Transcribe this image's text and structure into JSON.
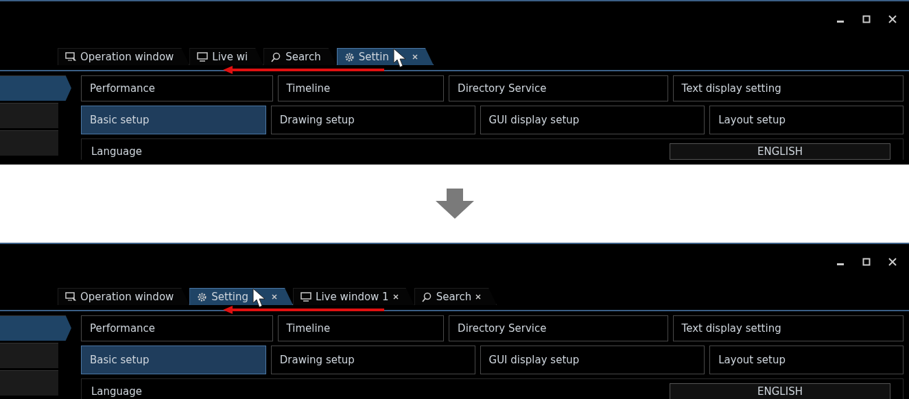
{
  "screens": [
    {
      "tabs": [
        {
          "kind": "operation",
          "label": "Operation window",
          "selected": false,
          "closable": false,
          "cursor": false
        },
        {
          "kind": "live",
          "label": "Live wi",
          "selected": false,
          "closable": false,
          "cursor": false
        },
        {
          "kind": "search",
          "label": "Search",
          "selected": false,
          "closable": false,
          "cursor": false
        },
        {
          "kind": "setting",
          "label": "Settin",
          "selected": true,
          "closable": true,
          "cursor": true
        }
      ],
      "drag_arrow": true,
      "sidebar": [
        {
          "selected": true
        },
        {
          "selected": false
        },
        {
          "selected": false
        }
      ],
      "menu_row_1": [
        {
          "label": "Performance",
          "selected": false
        },
        {
          "label": "Timeline",
          "selected": false
        },
        {
          "label": "Directory Service",
          "selected": false
        },
        {
          "label": "Text display setting",
          "selected": false
        }
      ],
      "menu_row_2": [
        {
          "label": "Basic setup",
          "selected": true
        },
        {
          "label": "Drawing setup",
          "selected": false
        },
        {
          "label": "GUI display setup",
          "selected": false
        },
        {
          "label": "Layout setup",
          "selected": false
        }
      ],
      "language": {
        "label": "Language",
        "value": "ENGLISH"
      }
    },
    {
      "tabs": [
        {
          "kind": "operation",
          "label": "Operation window",
          "selected": false,
          "closable": false,
          "cursor": false
        },
        {
          "kind": "setting",
          "label": "Setting",
          "selected": true,
          "closable": true,
          "cursor": true
        },
        {
          "kind": "live",
          "label": "Live window 1",
          "selected": false,
          "closable": true,
          "cursor": false
        },
        {
          "kind": "search",
          "label": "Search",
          "selected": false,
          "closable": true,
          "cursor": false
        }
      ],
      "drag_arrow": true,
      "sidebar": [
        {
          "selected": true
        },
        {
          "selected": false
        },
        {
          "selected": false
        }
      ],
      "menu_row_1": [
        {
          "label": "Performance",
          "selected": false
        },
        {
          "label": "Timeline",
          "selected": false
        },
        {
          "label": "Directory Service",
          "selected": false
        },
        {
          "label": "Text display setting",
          "selected": false
        }
      ],
      "menu_row_2": [
        {
          "label": "Basic setup",
          "selected": true
        },
        {
          "label": "Drawing setup",
          "selected": false
        },
        {
          "label": "GUI display setup",
          "selected": false
        },
        {
          "label": "Layout setup",
          "selected": false
        }
      ],
      "language": {
        "label": "Language",
        "value": "ENGLISH"
      }
    }
  ]
}
